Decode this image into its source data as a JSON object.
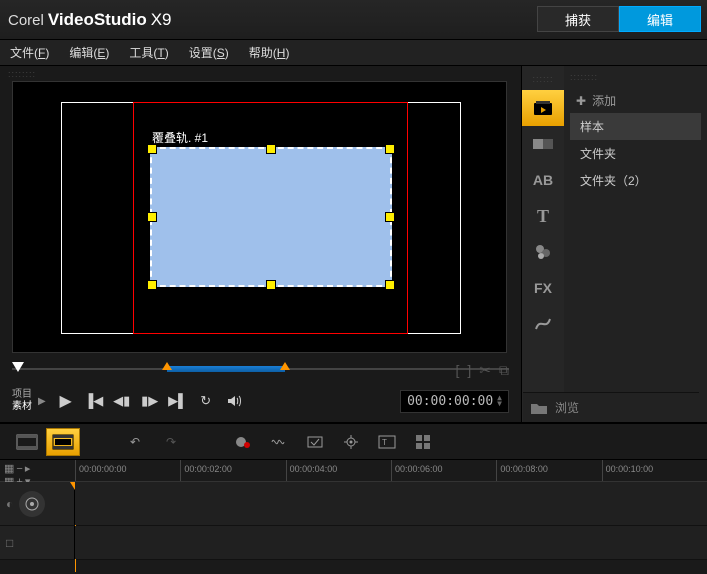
{
  "title": {
    "brand": "Corel",
    "product": "VideoStudio",
    "version": "X9"
  },
  "top_tabs": {
    "capture": "捕获",
    "edit": "编辑"
  },
  "menu": {
    "file": {
      "label": "文件",
      "key": "F"
    },
    "edit": {
      "label": "编辑",
      "key": "E"
    },
    "tools": {
      "label": "工具",
      "key": "T"
    },
    "settings": {
      "label": "设置",
      "key": "S"
    },
    "help": {
      "label": "帮助",
      "key": "H"
    }
  },
  "preview": {
    "overlay_label": "覆叠轨. #1"
  },
  "player": {
    "mode_project": "项目",
    "mode_clip": "素材",
    "timecode": "00:00:00:00"
  },
  "library": {
    "add": "添加",
    "items": [
      "样本",
      "文件夹",
      "文件夹（2）"
    ],
    "browse": "浏览"
  },
  "tool_strip": {
    "media": "media-library-icon",
    "transition": "transition-icon",
    "title": "AB",
    "text": "T",
    "graphic": "graphic-icon",
    "fx": "FX",
    "path": "path-icon"
  },
  "timeline": {
    "ticks": [
      "00:00:00:00",
      "00:00:02:00",
      "00:00:04:00",
      "00:00:06:00",
      "00:00:08:00",
      "00:00:10:00"
    ]
  }
}
